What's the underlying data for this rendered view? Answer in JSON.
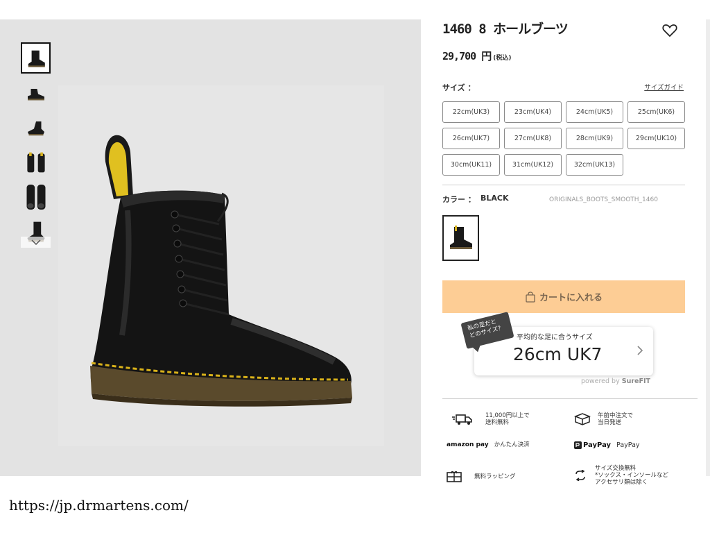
{
  "product": {
    "title": "1460 8 ホールブーツ",
    "price": "29,700 円",
    "tax_note": "(税込)"
  },
  "gallery": {
    "thumbnails": [
      "boot-side",
      "boot-low-side",
      "boot-angle",
      "boot-pair-back",
      "boot-pair-front",
      "boot-front"
    ],
    "main_image": "black-boot"
  },
  "size": {
    "label": "サイズ ：",
    "guide_link": "サイズガイド",
    "options": [
      "22cm(UK3)",
      "23cm(UK4)",
      "24cm(UK5)",
      "25cm(UK6)",
      "26cm(UK7)",
      "27cm(UK8)",
      "28cm(UK9)",
      "29cm(UK10)",
      "30cm(UK11)",
      "31cm(UK12)",
      "32cm(UK13)"
    ]
  },
  "color": {
    "label": "カラー ：",
    "value": "BLACK",
    "style_code": "ORIGINALS_BOOTS_SMOOTH_1460"
  },
  "cart": {
    "button_label": "カートに入れる",
    "icon": "bag-icon",
    "color": "#fdcd95"
  },
  "fit": {
    "bubble_line1": "私の足だと",
    "bubble_line2": "どのサイズ？",
    "caption": "平均的な足に合うサイズ",
    "value": "26cm UK7",
    "powered_prefix": "powered by ",
    "powered_brand": "SureFIT"
  },
  "features": {
    "shipping_free": {
      "line1": "11,000円以上で",
      "line2": "送料無料",
      "icon": "truck-icon"
    },
    "same_day": {
      "line1": "午前中注文で",
      "line2": "当日発送",
      "icon": "box-icon"
    },
    "amazon": {
      "logo": "amazon pay",
      "text": "かんたん決済"
    },
    "paypay": {
      "logo": "PayPay",
      "text": "PayPay"
    },
    "wrapping": {
      "text": "無料ラッピング",
      "icon": "gift-icon"
    },
    "exchange": {
      "line1": "サイズ交換無料",
      "line2": "*ソックス・インソールなど",
      "line3": "アクセサリ類は除く",
      "icon": "exchange-icon"
    }
  },
  "url": "https://jp.drmartens.com/"
}
